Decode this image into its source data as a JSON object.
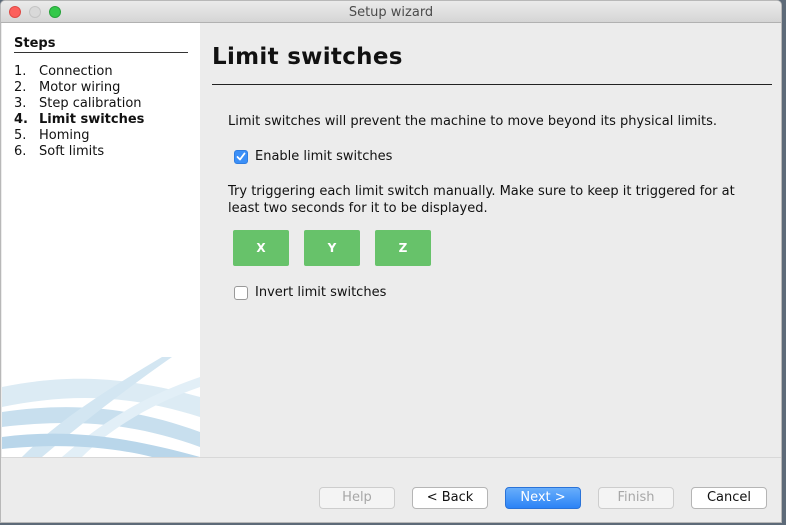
{
  "window": {
    "title": "Setup wizard"
  },
  "sidebar": {
    "title": "Steps",
    "steps": [
      {
        "number": "1.",
        "label": "Connection",
        "active": false
      },
      {
        "number": "2.",
        "label": "Motor wiring",
        "active": false
      },
      {
        "number": "3.",
        "label": "Step calibration",
        "active": false
      },
      {
        "number": "4.",
        "label": "Limit switches",
        "active": true
      },
      {
        "number": "5.",
        "label": "Homing",
        "active": false
      },
      {
        "number": "6.",
        "label": "Soft limits",
        "active": false
      }
    ]
  },
  "main": {
    "heading": "Limit switches",
    "description": "Limit switches will prevent the machine to move beyond its physical limits.",
    "enable_checkbox": {
      "label": "Enable limit switches",
      "checked": true
    },
    "hint": "Try triggering each limit switch manually. Make sure to keep it triggered for at least two seconds for it to be displayed.",
    "axes": [
      "X",
      "Y",
      "Z"
    ],
    "axis_color": "#67c26a",
    "invert_checkbox": {
      "label": "Invert limit switches",
      "checked": false
    }
  },
  "footer": {
    "help": "Help",
    "back": "< Back",
    "next": "Next >",
    "finish": "Finish",
    "cancel": "Cancel"
  }
}
